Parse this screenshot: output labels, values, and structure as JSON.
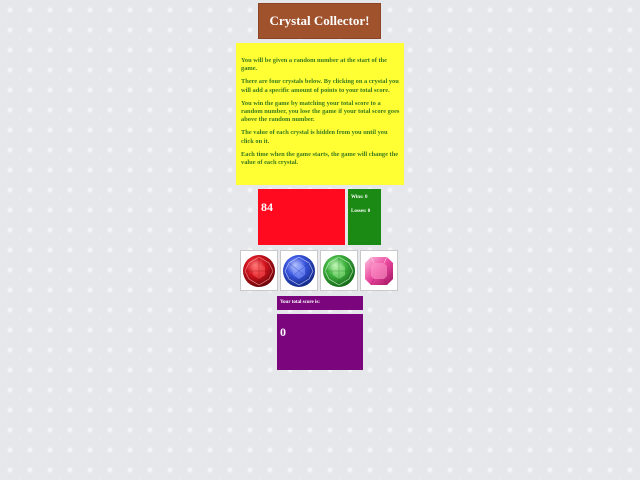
{
  "title": "Crystal Collector!",
  "instructions": [
    "You will be given a random number at the start of the game.",
    "There are four crystals below. By clicking on a crystal you will add a specific amount of points to your total score.",
    "You win the game by matching your total score to a random number, you lose the game if your total score goes above the random number.",
    "The value of each crystal is hidden from you until you click on it.",
    "Each time when the game starts, the game will change the value of each crystal."
  ],
  "target_number": "84",
  "stats": {
    "wins": "Wins: 0",
    "losses": "Losses: 0"
  },
  "crystals": [
    {
      "name": "red-crystal-icon",
      "color": "#d3141e"
    },
    {
      "name": "blue-crystal-icon",
      "color": "#3a56e0"
    },
    {
      "name": "green-crystal-icon",
      "color": "#3fb43f"
    },
    {
      "name": "pink-crystal-icon",
      "color": "#e8469c"
    }
  ],
  "score": {
    "label": "Your total score is:",
    "value": "0"
  },
  "colors": {
    "title_bg": "#a0522d",
    "instructions_bg": "#ffff33",
    "instructions_text": "#3b7a1e",
    "target_bg": "#ff0a1e",
    "stats_bg": "#1b8a14",
    "score_bg": "#7a057d"
  }
}
